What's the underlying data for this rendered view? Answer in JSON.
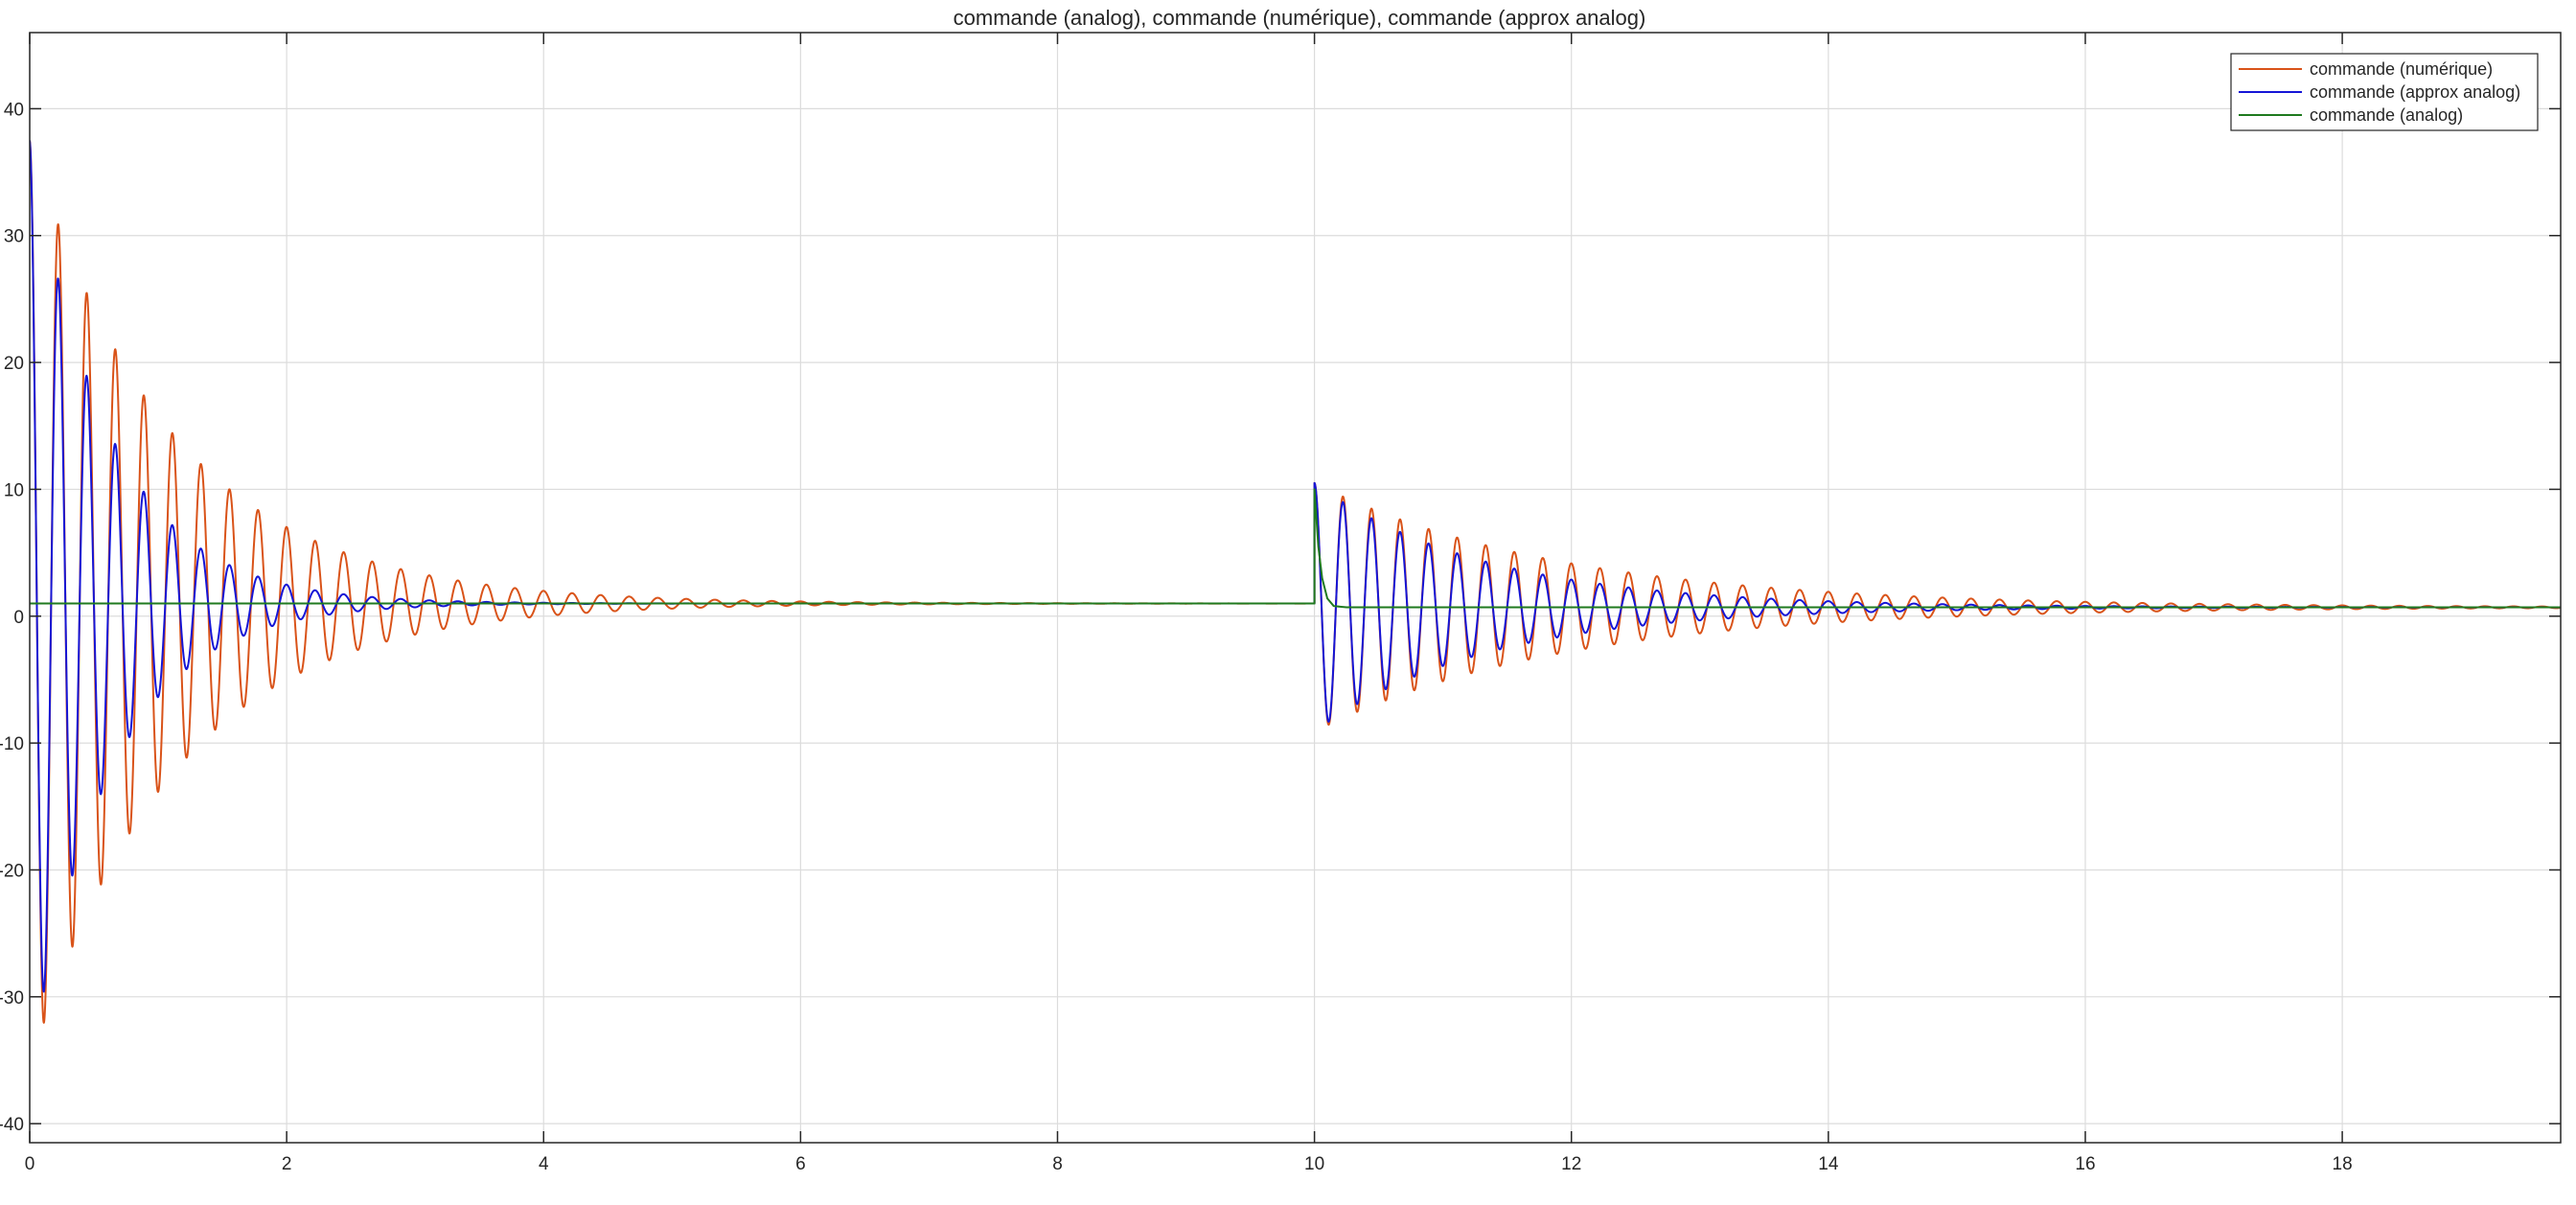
{
  "chart_data": {
    "type": "line",
    "title": "commande (analog), commande (numérique), commande (approx analog)",
    "xlabel": "",
    "ylabel": "",
    "xlim": [
      0,
      19.7
    ],
    "ylim": [
      -41.5,
      46
    ],
    "x_ticks": [
      0,
      2,
      4,
      6,
      8,
      10,
      12,
      14,
      16,
      18
    ],
    "y_ticks": [
      -40,
      -30,
      -20,
      -10,
      0,
      10,
      20,
      30,
      40
    ],
    "grid": true,
    "legend_position": "top-right",
    "series": [
      {
        "name": "commande (numérique)",
        "color": "#d95319",
        "segments": [
          {
            "t0": 0.0,
            "t1": 10.0,
            "offset": 1.0,
            "amp": 37.5,
            "decay": 0.9,
            "freq": 4.5
          },
          {
            "t0": 10.0,
            "t1": 19.7,
            "offset": 0.7,
            "amp": 10.5,
            "decay": 0.52,
            "freq": 4.5
          }
        ]
      },
      {
        "name": "commande (approx analog)",
        "color": "#1515d6",
        "segments": [
          {
            "t0": 0.0,
            "t1": 10.0,
            "offset": 1.0,
            "amp": 37.5,
            "decay": 1.6,
            "freq": 4.5
          },
          {
            "t0": 10.0,
            "t1": 19.7,
            "offset": 0.7,
            "amp": 10.5,
            "decay": 0.75,
            "freq": 4.5
          }
        ]
      },
      {
        "name": "commande (analog)",
        "color": "#1f7a1f",
        "points": [
          [
            0,
            1.0
          ],
          [
            10.0,
            1.0
          ],
          [
            10.0,
            10.0
          ],
          [
            10.03,
            5.5
          ],
          [
            10.06,
            3.0
          ],
          [
            10.1,
            1.4
          ],
          [
            10.15,
            0.8
          ],
          [
            10.25,
            0.7
          ],
          [
            19.7,
            0.7
          ]
        ]
      }
    ]
  }
}
